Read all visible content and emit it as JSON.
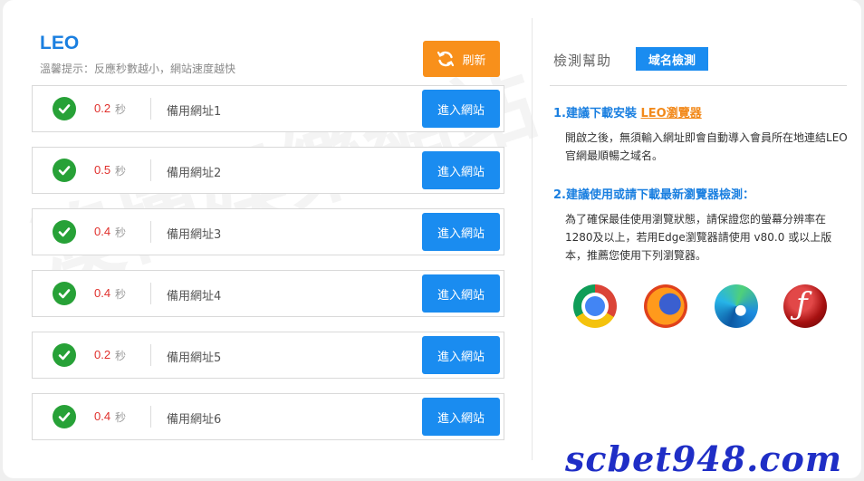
{
  "header": {
    "brand": "LEO",
    "hint": "溫馨提示：反應秒數越小，網站速度越快",
    "refresh_label": "刷新"
  },
  "rows": [
    {
      "speed": "0.2",
      "unit": "秒",
      "name": "備用網址1",
      "button": "進入網站"
    },
    {
      "speed": "0.5",
      "unit": "秒",
      "name": "備用網址2",
      "button": "進入網站"
    },
    {
      "speed": "0.4",
      "unit": "秒",
      "name": "備用網址3",
      "button": "進入網站"
    },
    {
      "speed": "0.4",
      "unit": "秒",
      "name": "備用網址4",
      "button": "進入網站"
    },
    {
      "speed": "0.2",
      "unit": "秒",
      "name": "備用網址5",
      "button": "進入網站"
    },
    {
      "speed": "0.4",
      "unit": "秒",
      "name": "備用網址6",
      "button": "進入網站"
    }
  ],
  "help": {
    "title": "檢測幫助",
    "domain_button": "域名檢測",
    "step1_prefix": "1.建議下載安裝",
    "step1_link": "LEO瀏覽器",
    "step1_text": "開啟之後，無須輸入網址即會自動導入會員所在地連結LEO官網最順暢之域名。",
    "step2_title": "2.建議使用或請下載最新瀏覽器檢測：",
    "step2_text": "為了確保最佳使用瀏覽狀態，請保證您的螢幕分辨率在1280及以上，若用Edge瀏覽器請使用 v80.0 或以上版本，推薦您使用下列瀏覽器。"
  },
  "browsers": [
    "chrome-icon",
    "firefox-icon",
    "edge-icon",
    "flash-icon"
  ],
  "colors": {
    "accent_blue": "#1a8cf0",
    "refresh_orange": "#f8901b",
    "check_green": "#27a137",
    "speed_red": "#e0302c"
  },
  "watermark": {
    "text": "澳博娛樂網站",
    "site": "scbet948.com"
  }
}
